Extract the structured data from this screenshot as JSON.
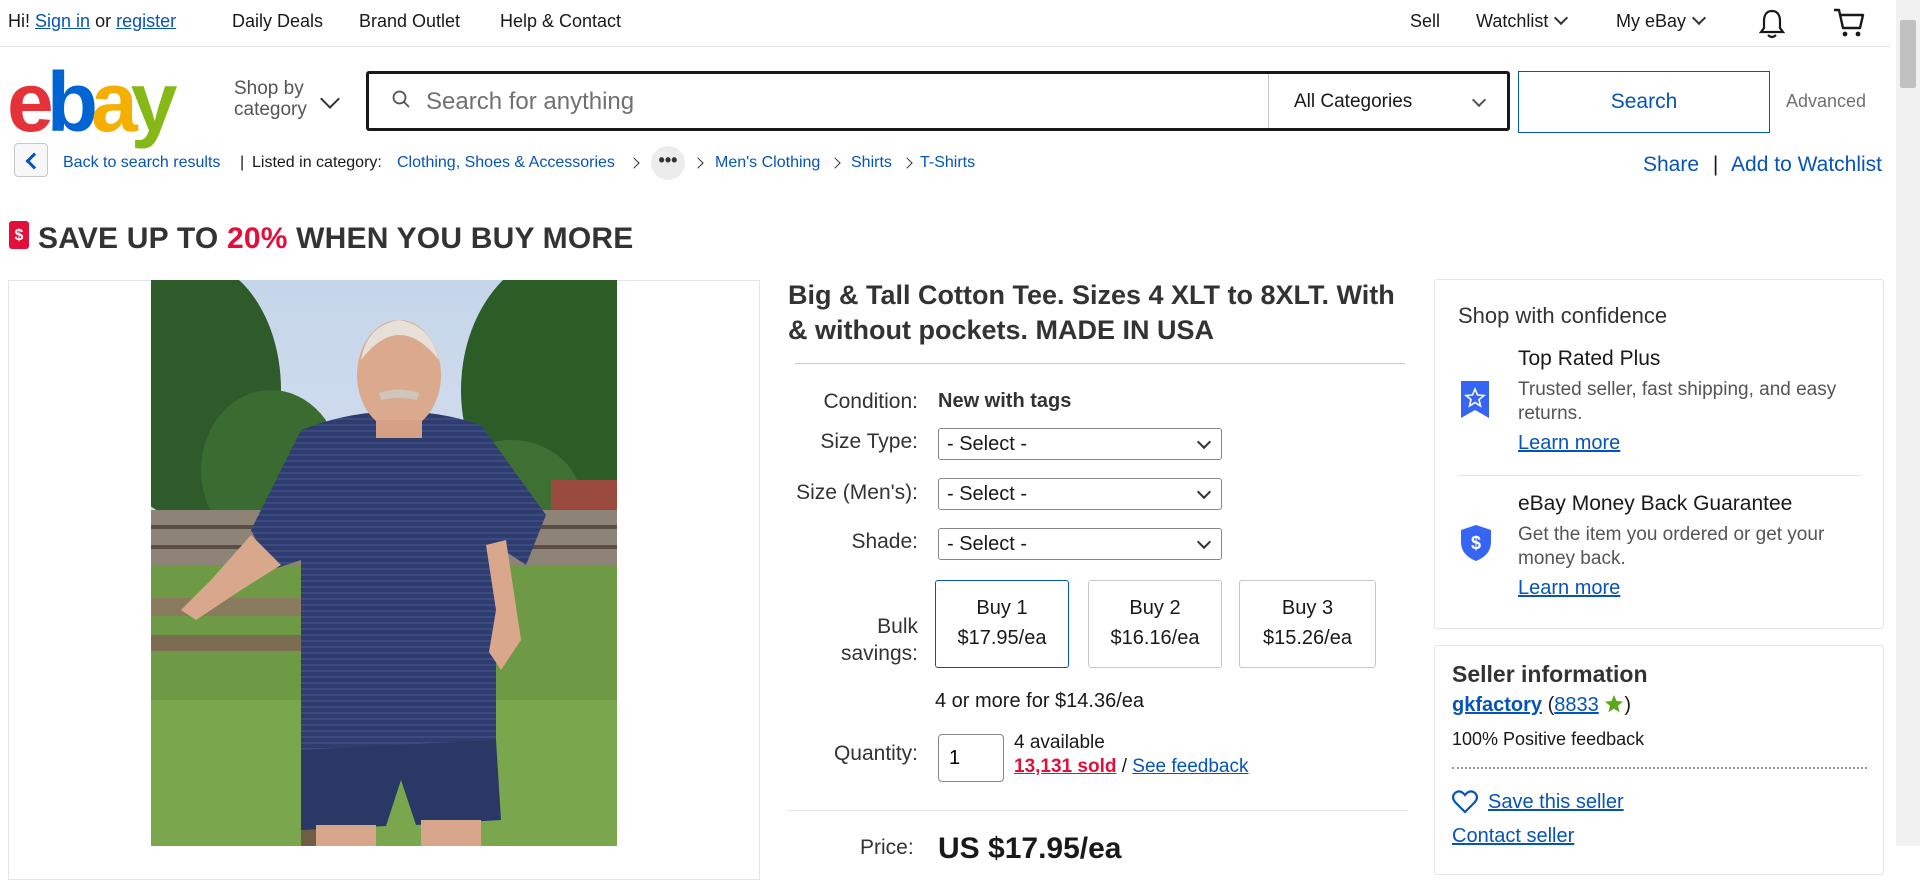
{
  "topbar": {
    "greeting": "Hi!",
    "sign_in": "Sign in",
    "or": "or",
    "register": "register",
    "daily_deals": "Daily Deals",
    "brand_outlet": "Brand Outlet",
    "help_contact": "Help & Contact",
    "sell": "Sell",
    "watchlist": "Watchlist",
    "my_ebay": "My eBay"
  },
  "header": {
    "logo_letters": [
      "e",
      "b",
      "a",
      "y"
    ],
    "shop_by_category": [
      "Shop by",
      "category"
    ],
    "search_placeholder": "Search for anything",
    "category_select": "All Categories",
    "search_button": "Search",
    "advanced": "Advanced"
  },
  "breadcrumb": {
    "back": "Back to search results",
    "listed_in": "Listed in category:",
    "items": [
      "Clothing, Shoes & Accessories",
      "Men's Clothing",
      "Shirts",
      "T-Shirts"
    ],
    "more": "•••",
    "share": "Share",
    "add_to_watchlist": "Add to Watchlist"
  },
  "promo": {
    "icon": "$",
    "prefix": "SAVE UP TO",
    "percent": "20%",
    "suffix": "WHEN YOU BUY MORE"
  },
  "item": {
    "title": "Big & Tall Cotton Tee. Sizes 4 XLT to 8XLT. With & without pockets. MADE IN USA",
    "condition_label": "Condition:",
    "condition_value": "New with tags",
    "size_type_label": "Size Type:",
    "size_label": "Size (Men's):",
    "shade_label": "Shade:",
    "select_default": "- Select -",
    "bulk_label": [
      "Bulk",
      "savings:"
    ],
    "bulk_options": [
      {
        "qty": "Buy 1",
        "price": "$17.95/ea"
      },
      {
        "qty": "Buy 2",
        "price": "$16.16/ea"
      },
      {
        "qty": "Buy 3",
        "price": "$15.26/ea"
      }
    ],
    "bulk_more": "4 or more for $14.36/ea",
    "quantity_label": "Quantity:",
    "quantity_value": "1",
    "available": "4 available",
    "sold": "13,131 sold",
    "sold_sep": "/",
    "see_feedback": "See feedback",
    "price_label": "Price:",
    "price_value": "US $17.95/ea"
  },
  "confidence": {
    "title": "Shop with confidence",
    "items": [
      {
        "heading": "Top Rated Plus",
        "desc": "Trusted seller, fast shipping, and easy returns.",
        "link": "Learn more",
        "icon": "top-rated-badge-icon"
      },
      {
        "heading": "eBay Money Back Guarantee",
        "desc": "Get the item you ordered or get your money back.",
        "link": "Learn more",
        "icon": "money-back-shield-icon"
      }
    ]
  },
  "seller": {
    "title": "Seller information",
    "name": "gkfactory",
    "score": "8833",
    "feedback": "100% Positive feedback",
    "save": "Save this seller",
    "contact": "Contact seller"
  },
  "colors": {
    "link": "#0654ba",
    "accent_red": "#e0103a",
    "text": "#191919",
    "border": "#c7c7c7"
  }
}
